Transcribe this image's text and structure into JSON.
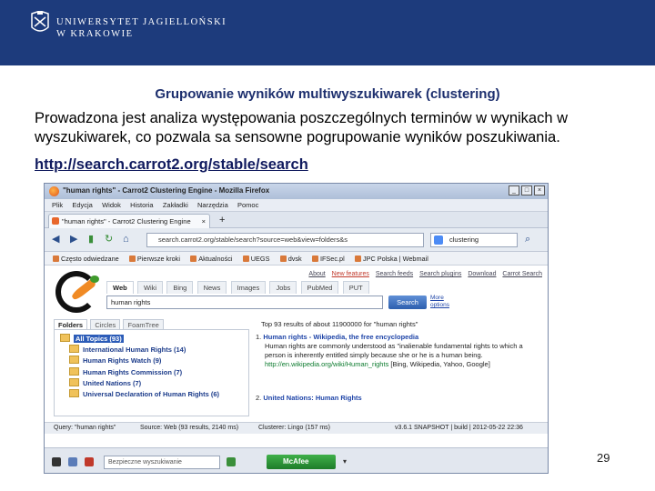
{
  "header": {
    "university_line1": "UNIWERSYTET JAGIELLOŃSKI",
    "university_line2": "W KRAKOWIE"
  },
  "slide": {
    "title": "Grupowanie wyników multiwyszukiwarek (clustering)",
    "body": "Prowadzona jest analiza występowania poszczególnych terminów w wynikach w wyszukiwarek, co pozwala sa sensowne pogrupowanie wyników poszukiwania.",
    "link": "http://search.carrot2.org/stable/search",
    "page_number": "29"
  },
  "browser": {
    "window_title": "\"human rights\" - Carrot2 Clustering Engine - Mozilla Firefox",
    "window_buttons": [
      "_",
      "□",
      "×"
    ],
    "menu": [
      "Plik",
      "Edycja",
      "Widok",
      "Historia",
      "Zakładki",
      "Narzędzia",
      "Pomoc"
    ],
    "tab_label": "\"human rights\" - Carrot2 Clustering Engine",
    "tab_close": "×",
    "new_tab": "+",
    "url": "search.carrot2.org/stable/search?source=web&view=folders&s",
    "search_engine_query": "clustering",
    "bookmarks": [
      "Często odwiedzane",
      "Pierwsze kroki",
      "Aktualności",
      "UEGS",
      "dvsk",
      "IFSec.pl",
      "JPC Polska | Webmail"
    ],
    "toplinks": [
      "About",
      "New features",
      "Search feeds",
      "Search plugins",
      "Download",
      "Carrot Search"
    ],
    "source_tabs": [
      "Web",
      "Wiki",
      "Bing",
      "News",
      "Images",
      "Jobs",
      "PubMed",
      "PUT"
    ],
    "query": "human rights",
    "search_button": "Search",
    "more_options": "More options",
    "view_tabs": [
      "Folders",
      "Circles",
      "FoamTree"
    ],
    "folders": [
      "All Topics (93)",
      "International Human Rights (14)",
      "Human Rights Watch (9)",
      "Human Rights Commission (7)",
      "United Nations (7)",
      "Universal Declaration of Human Rights (6)"
    ],
    "results_header": "Top 93 results of about 11900000 for \"human rights\"",
    "results": [
      {
        "num": "1.",
        "title": "Human rights - Wikipedia, the free encyclopedia",
        "snippet": "Human rights are commonly understood as \"inalienable fundamental rights to which a person is inherently entitled simply because she or he is a human being.",
        "url": "http://en.wikipedia.org/wiki/Human_rights",
        "sources": "[Bing, Wikipedia, Yahoo, Google]"
      },
      {
        "num": "2.",
        "title": "United Nations: Human Rights",
        "snippet": "",
        "url": "",
        "sources": ""
      }
    ],
    "status_query": "Query: \"human rights\"",
    "status_source": "Source: Web (93 results, 2140 ms)",
    "status_clusterer": "Clusterer: Lingo (157 ms)",
    "status_version": "v3.6.1 SNAPSHOT | build | 2012-05-22 22:36",
    "find_placeholder": "Bezpieczne wyszukiwanie",
    "mcafee_label": "McAfee"
  },
  "colors": {
    "header_bg": "#1d3b7c",
    "title_text": "#1d2f6e",
    "mcafee_green": "#2f9a3c"
  }
}
